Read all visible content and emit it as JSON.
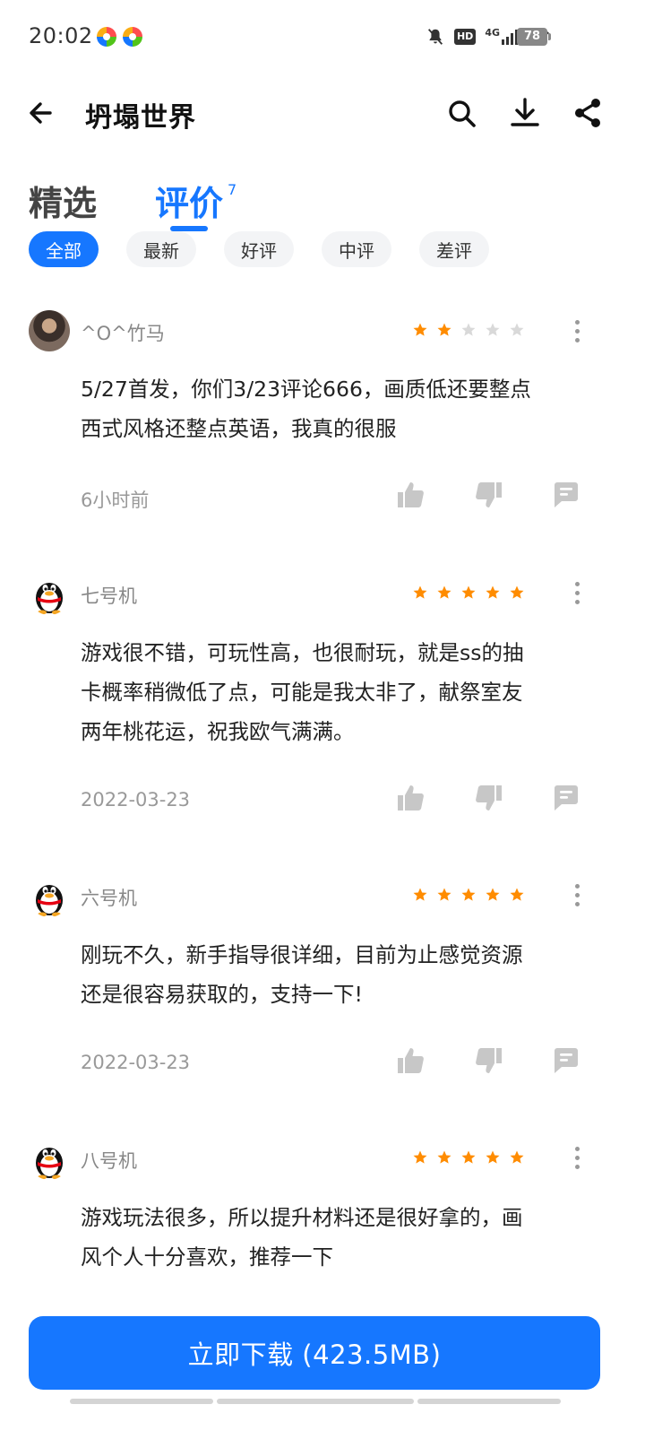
{
  "status_bar": {
    "time": "20:02",
    "hd": "HD",
    "network": "4G",
    "battery": "78"
  },
  "header": {
    "title": "坍塌世界",
    "back_icon": "arrow-left-icon",
    "search_icon": "search-icon",
    "download_icon": "download-icon",
    "share_icon": "share-icon"
  },
  "tabs": [
    {
      "label": "精选",
      "active": false
    },
    {
      "label": "评价",
      "active": true,
      "count": "7"
    }
  ],
  "filters": [
    {
      "label": "全部",
      "active": true
    },
    {
      "label": "最新",
      "active": false
    },
    {
      "label": "好评",
      "active": false
    },
    {
      "label": "中评",
      "active": false
    },
    {
      "label": "差评",
      "active": false
    }
  ],
  "reviews": [
    {
      "user": "^O^竹马",
      "avatar": "photo",
      "rating": 2,
      "text_lines": [
        "5/27首发，你们3/23评论666，画质低还要整点",
        "西式风格还整点英语，我真的很服"
      ],
      "date": "6小时前"
    },
    {
      "user": "七号机",
      "avatar": "penguin",
      "rating": 5,
      "text_lines": [
        "游戏很不错，可玩性高，也很耐玩，就是ss的抽",
        "卡概率稍微低了点，可能是我太非了，献祭室友",
        "两年桃花运，祝我欧气满满。"
      ],
      "date": "2022-03-23"
    },
    {
      "user": "六号机",
      "avatar": "penguin",
      "rating": 5,
      "text_lines": [
        "刚玩不久，新手指导很详细，目前为止感觉资源",
        "还是很容易获取的，支持一下!"
      ],
      "date": "2022-03-23"
    },
    {
      "user": "八号机",
      "avatar": "penguin",
      "rating": 5,
      "text_lines": [
        "游戏玩法很多，所以提升材料还是很好拿的，画",
        "风个人十分喜欢，推荐一下"
      ]
    }
  ],
  "colors": {
    "accent": "#1677ff",
    "star_on": "#ff8c00",
    "star_off": "#d9d9d9",
    "action_icon": "#c7c7c7"
  },
  "download": {
    "label": "立即下载 (423.5MB)"
  }
}
